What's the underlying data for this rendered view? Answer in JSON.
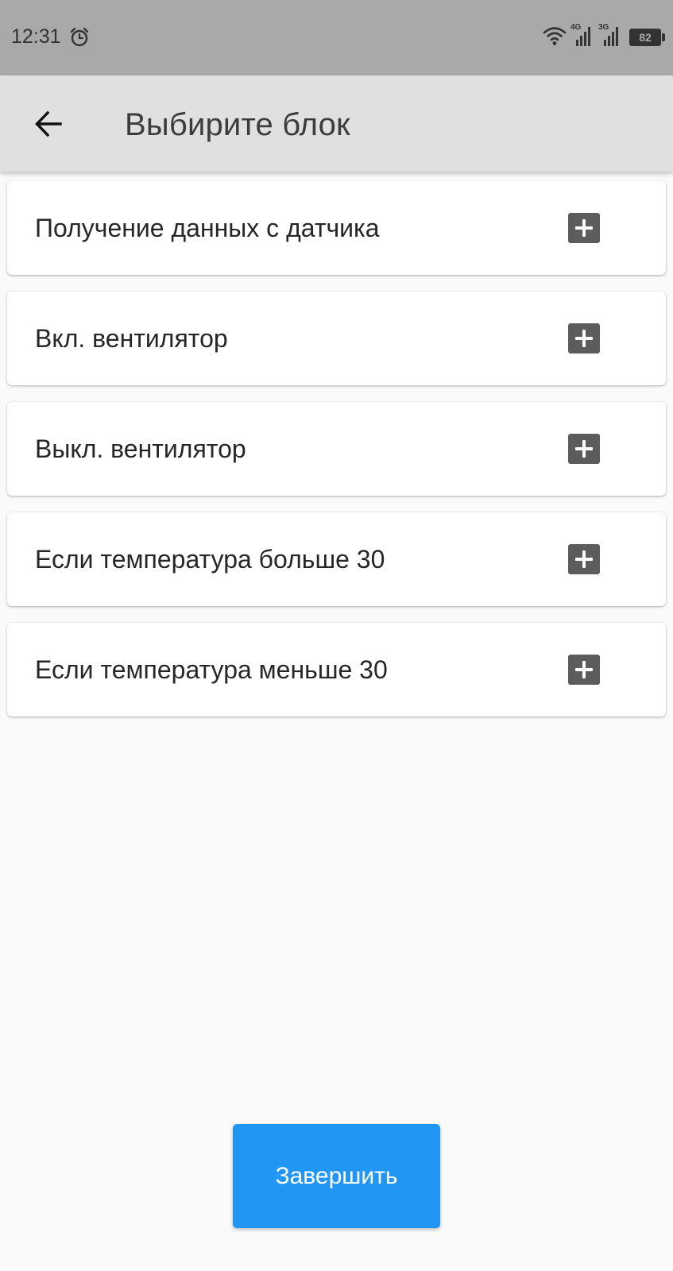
{
  "status_bar": {
    "time": "12:31",
    "alarm_icon": "alarm-clock-icon",
    "wifi_icon": "wifi-icon",
    "signal_1_label": "4G",
    "signal_2_label": "3G",
    "battery_level": "82"
  },
  "app_bar": {
    "back_icon": "arrow-left-icon",
    "title": "Выбирите блок",
    "background": "#e0e0e0"
  },
  "blocks": [
    {
      "label": "Получение данных с датчика",
      "action_icon": "plus-square-icon"
    },
    {
      "label": "Вкл. вентилятор",
      "action_icon": "plus-square-icon"
    },
    {
      "label": "Выкл. вентилятор",
      "action_icon": "plus-square-icon"
    },
    {
      "label": "Если температура больше 30",
      "action_icon": "plus-square-icon"
    },
    {
      "label": "Если температура меньше 30",
      "action_icon": "plus-square-icon"
    }
  ],
  "finish_button": {
    "label": "Завершить",
    "color": "#2196f3"
  }
}
